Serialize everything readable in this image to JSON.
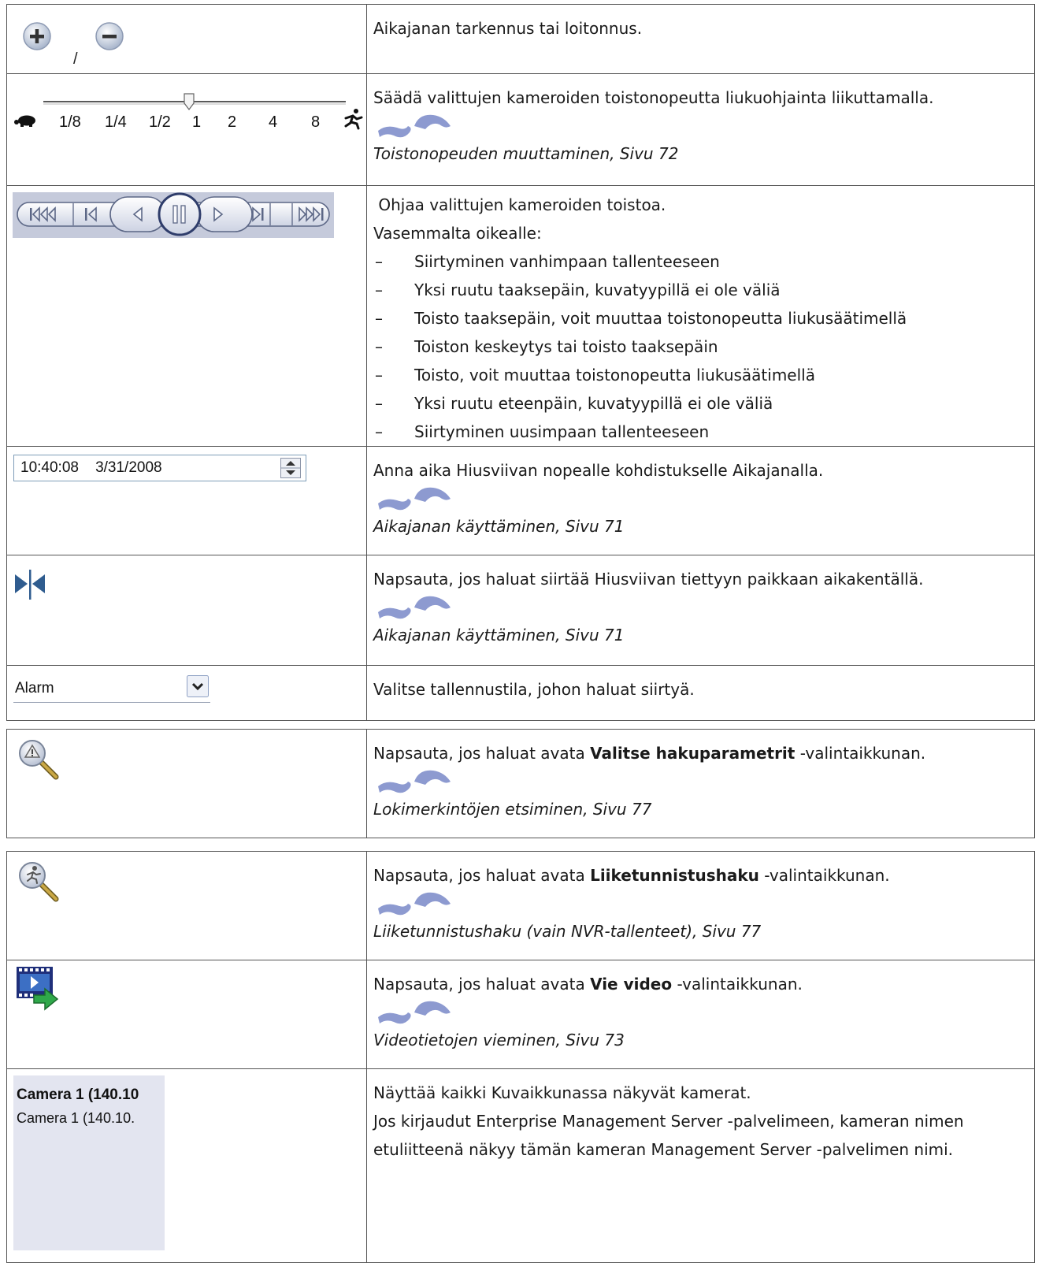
{
  "rows1": [
    {
      "text": "Aikajanan tarkennus tai loitonnus."
    },
    {
      "text": "Säädä valittujen kameroiden toistonopeutta liukuohjainta liikuttamalla.",
      "xref": "Toistonopeuden muuttaminen, Sivu 72"
    },
    {
      "text": "Ohjaa valittujen kameroiden toistoa.",
      "sub": "Vasemmalta oikealle:",
      "items": [
        "Siirtyminen vanhimpaan tallenteeseen",
        "Yksi ruutu taaksepäin, kuvatyypillä ei ole väliä",
        "Toisto taaksepäin, voit muuttaa toistonopeutta liukusäätimellä",
        "Toiston keskeytys tai toisto taaksepäin",
        "Toisto, voit muuttaa toistonopeutta liukusäätimellä",
        "Yksi ruutu eteenpäin, kuvatyypillä ei ole väliä",
        "Siirtyminen uusimpaan tallenteeseen"
      ]
    },
    {
      "text": "Anna aika Hiusviivan nopealle kohdistukselle Aikajanalla.",
      "xref": "Aikajanan käyttäminen, Sivu 71"
    },
    {
      "text": "Napsauta, jos haluat siirtää Hiusviivan tiettyyn paikkaan aikakentällä.",
      "xref": "Aikajanan käyttäminen, Sivu 71"
    },
    {
      "text": "Valitse tallennustila, johon haluat siirtyä."
    }
  ],
  "rows2": [
    {
      "pre": "Napsauta, jos haluat avata ",
      "bold": "Valitse hakuparametrit",
      "post": " -valintaikkunan.",
      "xref": "Lokimerkintöjen etsiminen, Sivu 77"
    }
  ],
  "rows3": [
    {
      "pre": "Napsauta, jos haluat avata ",
      "bold": "Liiketunnistushaku",
      "post": " -valintaikkunan.",
      "xref": "Liiketunnistushaku (vain NVR-tallenteet), Sivu 77"
    },
    {
      "pre": "Napsauta, jos haluat avata ",
      "bold": "Vie video",
      "post": " -valintaikkunan.",
      "xref": "Videotietojen vieminen, Sivu 73"
    },
    {
      "text": "Näyttää kaikki Kuvaikkunassa näkyvät kamerat.",
      "text2": "Jos kirjaudut Enterprise Management Server -palvelimeen, kameran nimen etuliitteenä näkyy tämän kameran Management Server -palvelimen nimi."
    }
  ],
  "controls": {
    "zoom_separator": "/",
    "speed_labels": [
      "1/8",
      "1/4",
      "1/2",
      "1",
      "2",
      "4",
      "8"
    ],
    "time_value": "10:40:08    3/31/2008",
    "mode_value": "Alarm",
    "camera_bold": "Camera 1 (140.10",
    "camera_normal": "Camera 1 (140.10."
  }
}
